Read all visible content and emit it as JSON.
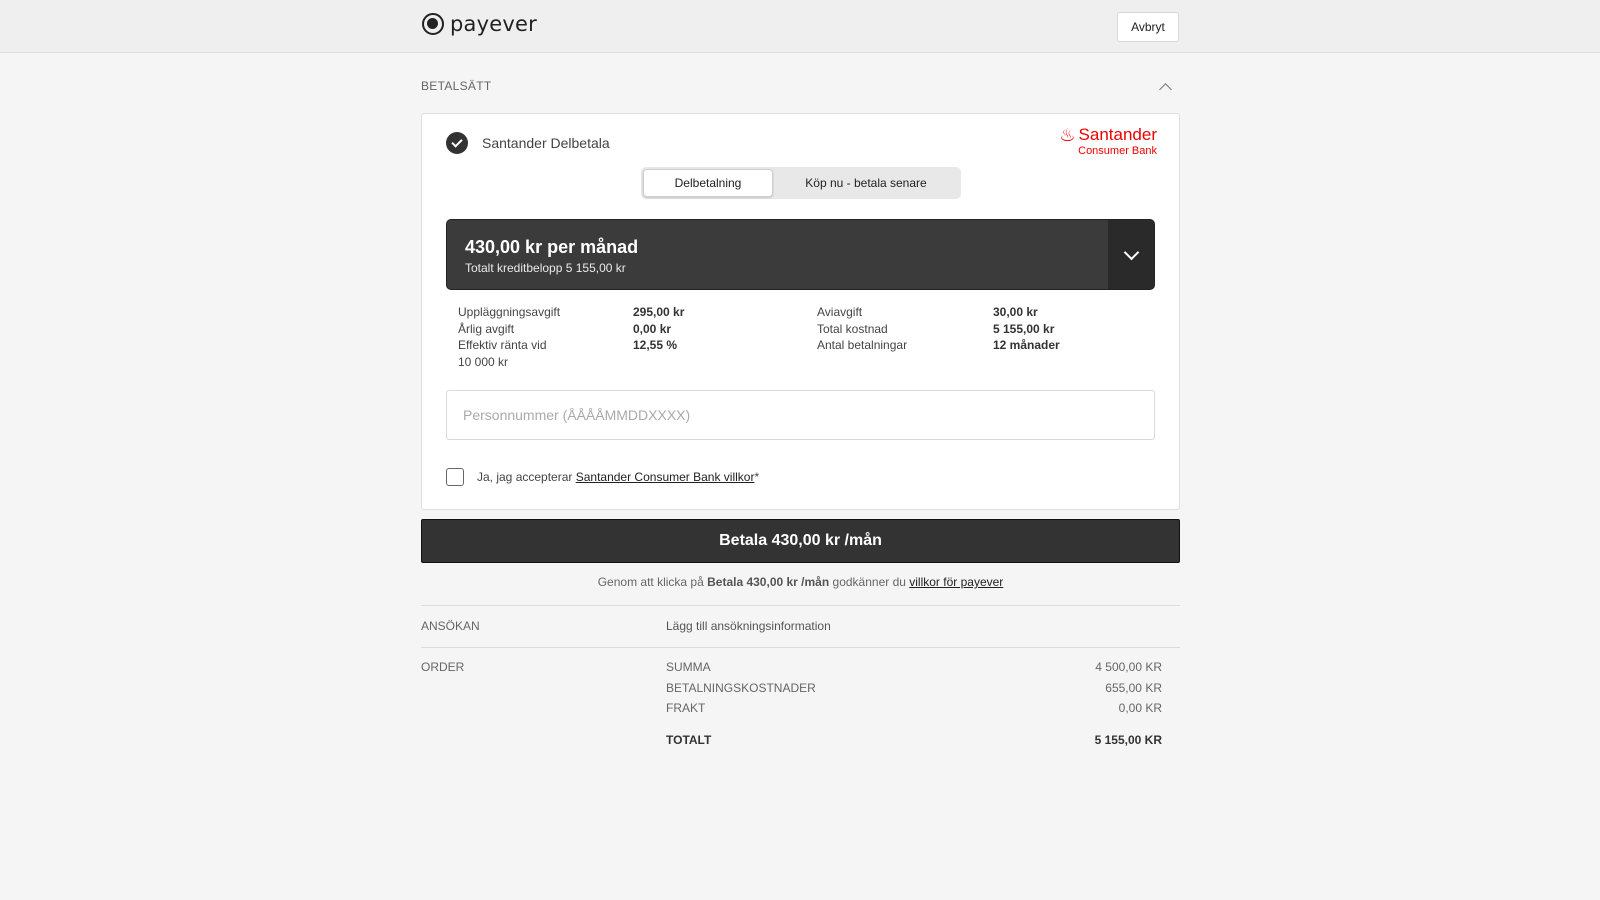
{
  "header": {
    "logo_text": "payever",
    "cancel_label": "Avbryt"
  },
  "payment_section": {
    "title": "BETALSÄTT",
    "method_name": "Santander Delbetala",
    "brand_name": "Santander",
    "brand_sub": "Consumer Bank",
    "toggle": [
      {
        "label": "Delbetalning",
        "active": true
      },
      {
        "label": "Köp nu - betala senare",
        "active": false
      }
    ],
    "plan": {
      "title": "430,00 kr per månad",
      "subtitle": "Totalt kreditbelopp 5 155,00 kr"
    },
    "details_left": [
      {
        "label": "Uppläggningsavgift",
        "value": "295,00 kr"
      },
      {
        "label": "Årlig avgift",
        "value": "0,00 kr"
      },
      {
        "label": "Effektiv ränta vid",
        "value": "12,55 %"
      },
      {
        "label": "10 000 kr",
        "value": ""
      }
    ],
    "details_right": [
      {
        "label": "Aviavgift",
        "value": "30,00 kr"
      },
      {
        "label": "Total kostnad",
        "value": "5 155,00 kr"
      },
      {
        "label": "Antal betalningar",
        "value": "12 månader"
      }
    ],
    "personal_number_placeholder": "Personnummer (ÅÅÅÅMMDDXXXX)",
    "terms_prefix": "Ja, jag accepterar ",
    "terms_link": "Santander Consumer Bank villkor",
    "terms_suffix": "*"
  },
  "pay_button_label": "Betala 430,00 kr /mån",
  "consent": {
    "prefix": "Genom att klicka på ",
    "bold": "Betala 430,00 kr /mån",
    "middle": " godkänner du ",
    "link": "villkor för payever"
  },
  "application": {
    "label": "ANSÖKAN",
    "value": "Lägg till ansökningsinformation"
  },
  "order": {
    "label": "ORDER",
    "lines": [
      {
        "label": "SUMMA",
        "value": "4 500,00 KR"
      },
      {
        "label": "BETALNINGSKOSTNADER",
        "value": "655,00 KR"
      },
      {
        "label": "FRAKT",
        "value": "0,00 KR"
      }
    ],
    "total": {
      "label": "TOTALT",
      "value": "5 155,00 KR"
    }
  },
  "colors": {
    "brand_red": "#ec0000",
    "dark": "#333333",
    "background": "#f5f5f5"
  }
}
